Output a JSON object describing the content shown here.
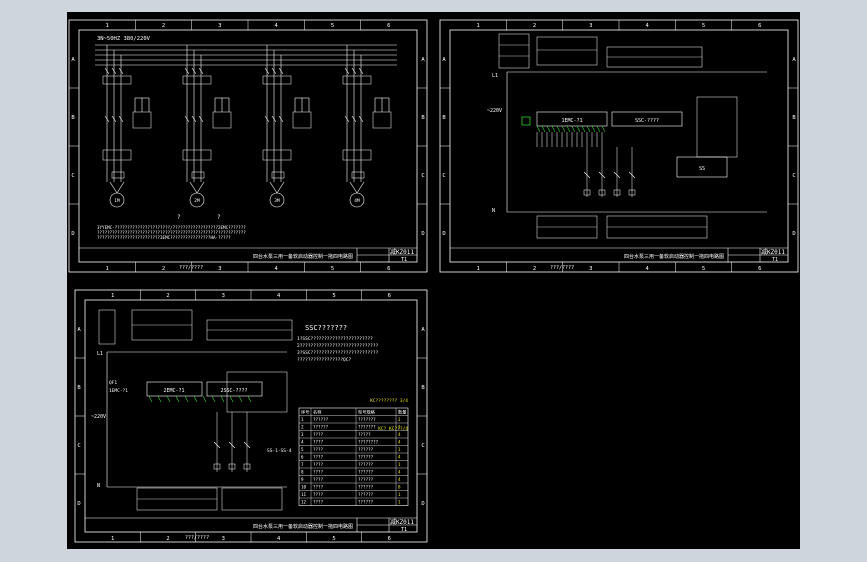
{
  "viewer": {
    "background_color": "#cfd5dc",
    "canvas_color": "#000000",
    "line_color": "#ffffff",
    "accent_green": "#2bd42b",
    "accent_yellow": "#e6e61e"
  },
  "grid": {
    "cols": [
      "1",
      "2",
      "3",
      "4",
      "5",
      "6"
    ],
    "rows": [
      "A",
      "B",
      "C",
      "D"
    ]
  },
  "sheet1": {
    "supply_label": "3N~50HZ 380/220V",
    "motor_labels": [
      "1M",
      "2M",
      "3M",
      "4M"
    ],
    "note_mark_1": "?",
    "note_mark_2": "?",
    "note_lines": [
      "3YYEMC-??????????????????????/??????????????????2EMC???????",
      "???????????????????????????????????????????????????????????",
      "?????????????????????????3EMC????????????????HA-?????"
    ],
    "title": "四台水泵三用一备软启动器控制一拖四电路图",
    "drawing_no": "减KZ011",
    "drawing_sub": "T1",
    "footer_text": "???/????"
  },
  "sheet2": {
    "label_l1": "L1",
    "label_n": "N",
    "label_voltage": "~220V",
    "device_1": "1EMC-?1",
    "device_2": "SSC-????",
    "device_3": "SS",
    "title": "四台水泵三用一备软启动器控制一拖四电路图",
    "drawing_no": "减KZ011",
    "drawing_sub": "T1",
    "footer_text": "???/????"
  },
  "sheet3": {
    "label_l1": "L1",
    "label_n": "N",
    "label_voltage": "~220V",
    "label_qf": "QF1",
    "label_km": "1EMC-?1",
    "device_1": "2EMC-?1",
    "device_2": "2SSC-????",
    "device_3": "SS-1-SS-4",
    "note_title": "SSC???????",
    "note_lines": [
      "1?SSC???????????????????????",
      "2?????????????????????????????",
      "3?SSC?????????????????????????",
      "?????????????????QC?"
    ],
    "table_header_yellow": "KC???????? 3/4",
    "table_header_yellow_2": "KC? KC???/4",
    "table_columns": [
      "序号",
      "名称",
      "型号规格",
      "数量"
    ],
    "table_rows": [
      [
        "1",
        "??????",
        "???????",
        "1"
      ],
      [
        "2",
        "??????",
        "???????",
        "1"
      ],
      [
        "3",
        "????",
        "?????",
        "4"
      ],
      [
        "4",
        "????",
        "????????",
        "4"
      ],
      [
        "5",
        "????",
        "??????",
        "1"
      ],
      [
        "6",
        "????",
        "??????",
        "4"
      ],
      [
        "7",
        "????",
        "??????",
        "1"
      ],
      [
        "8",
        "????",
        "??????",
        "4"
      ],
      [
        "9",
        "????",
        "??????",
        "4"
      ],
      [
        "10",
        "????",
        "??????",
        "8"
      ],
      [
        "11",
        "????",
        "??????",
        "1"
      ],
      [
        "12",
        "????",
        "??????",
        "1"
      ]
    ],
    "title": "四台水泵三用一备软启动器控制一拖四电路图",
    "drawing_no": "减KZ011",
    "drawing_sub": "T1",
    "footer_text": "???/????"
  }
}
